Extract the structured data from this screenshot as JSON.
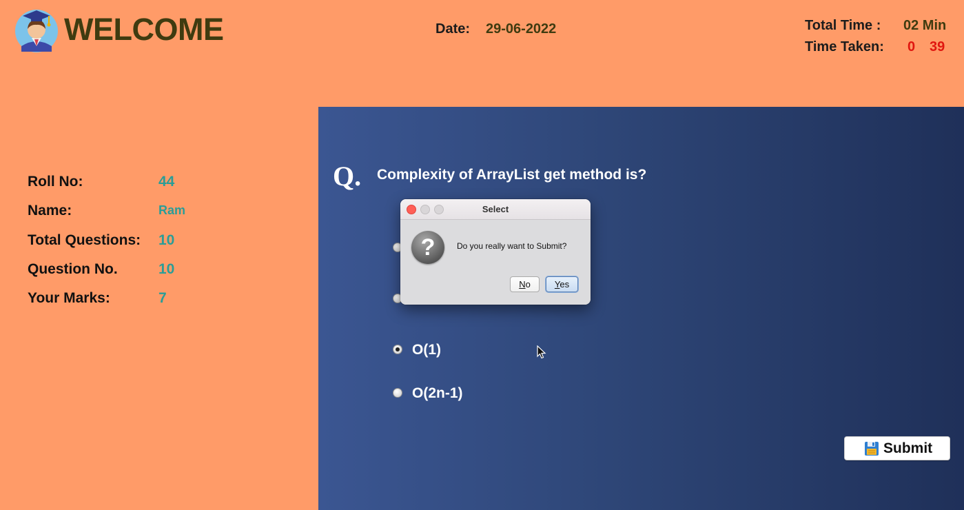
{
  "header": {
    "welcome": "WELCOME",
    "date_label": "Date:",
    "date_value": "29-06-2022",
    "total_time_label": "Total Time :",
    "total_time_value": "02 Min",
    "time_taken_label": "Time Taken:",
    "time_taken_min": "0",
    "time_taken_sec": "39",
    "logo_icon": "graduate-avatar-icon"
  },
  "info": {
    "roll_label": "Roll No:",
    "roll_value": "44",
    "name_label": "Name:",
    "name_value": "Ram",
    "total_q_label": "Total Questions:",
    "total_q_value": "10",
    "q_no_label": "Question No.",
    "q_no_value": "10",
    "marks_label": "Your Marks:",
    "marks_value": "7"
  },
  "question": {
    "mark": "Q.",
    "text": "Complexity of ArrayList get method is?",
    "options": [
      {
        "label": "",
        "selected": false
      },
      {
        "label": "",
        "selected": false
      },
      {
        "label": "O(1)",
        "selected": true
      },
      {
        "label": "O(2n-1)",
        "selected": false
      }
    ]
  },
  "submit": {
    "label": "Submit",
    "icon": "floppy-disk-icon"
  },
  "dialog": {
    "title": "Select",
    "message": "Do you really want to Submit?",
    "icon": "question-icon",
    "no_mnemonic": "N",
    "no_rest": "o",
    "yes_mnemonic": "Y",
    "yes_rest": "es"
  },
  "colors": {
    "background": "#ff9b68",
    "panel": "#2e4677",
    "accent_value": "#2a9d97",
    "time_red": "#e0160f",
    "header_text": "#3f3b10"
  }
}
